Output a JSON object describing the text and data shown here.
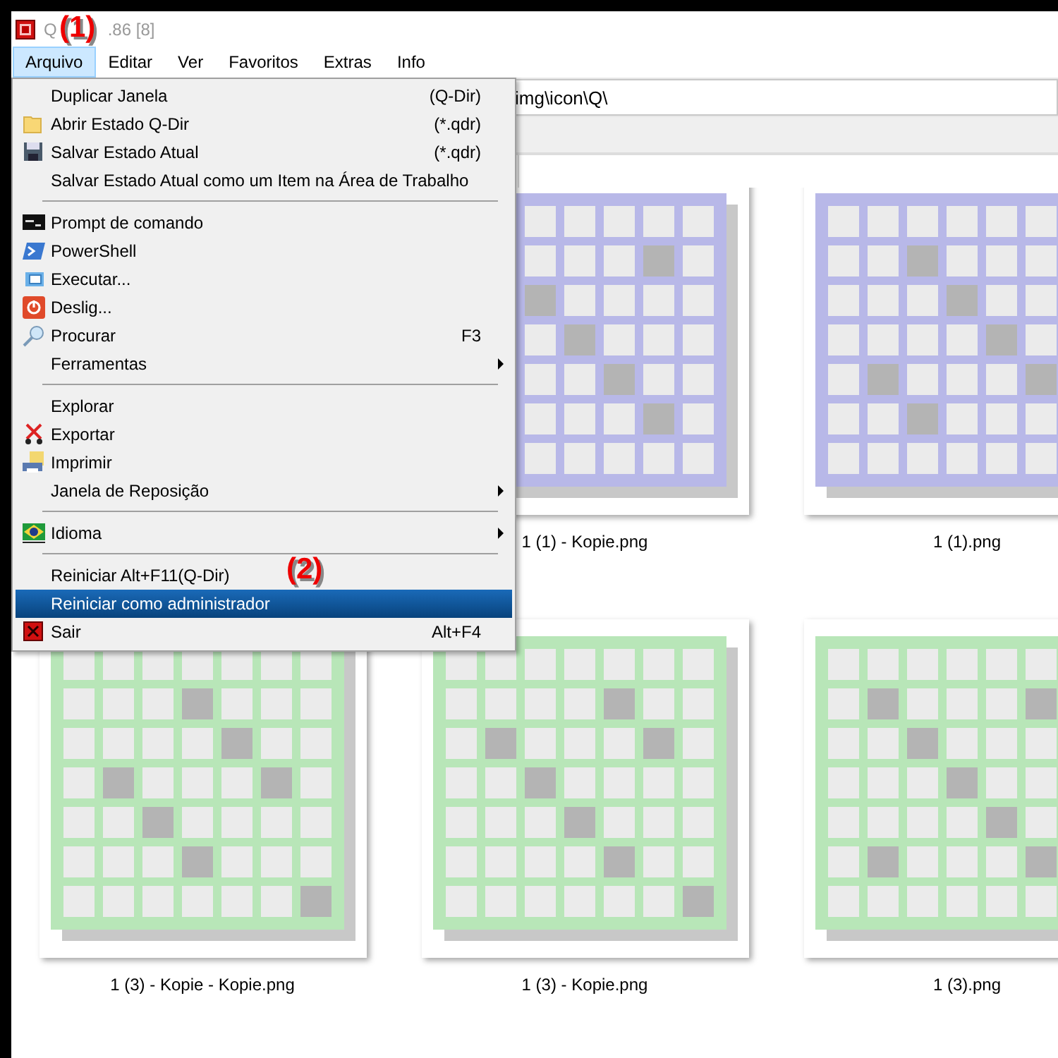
{
  "window": {
    "title_parts": [
      "Q",
      ".86 [8]"
    ]
  },
  "menu_bar": [
    {
      "label": "Arquivo",
      "selected": true
    },
    {
      "label": "Editar",
      "selected": false
    },
    {
      "label": "Ver",
      "selected": false
    },
    {
      "label": "Favoritos",
      "selected": false
    },
    {
      "label": "Extras",
      "selected": false
    },
    {
      "label": "Info",
      "selected": false
    }
  ],
  "address": {
    "value": "img\\icon\\Q\\"
  },
  "menu": [
    {
      "kind": "item",
      "label": "Duplicar Janela",
      "shortcut": "(Q-Dir)",
      "selected": false
    },
    {
      "kind": "item",
      "label": "Abrir Estado Q-Dir",
      "shortcut": "(*.qdr)",
      "selected": false
    },
    {
      "kind": "item",
      "label": "Salvar Estado Atual",
      "shortcut": "(*.qdr)",
      "selected": false
    },
    {
      "kind": "item",
      "label": "Salvar Estado Atual como um Item na Área de Trabalho",
      "selected": false
    },
    {
      "kind": "separator"
    },
    {
      "kind": "item",
      "label": "Prompt de comando",
      "selected": false
    },
    {
      "kind": "item",
      "label": "PowerShell",
      "selected": false
    },
    {
      "kind": "item",
      "label": "Executar...",
      "selected": false
    },
    {
      "kind": "item",
      "label": "Deslig...",
      "selected": false
    },
    {
      "kind": "item",
      "label": "Procurar",
      "shortcut": "F3",
      "selected": false
    },
    {
      "kind": "item",
      "label": "Ferramentas",
      "submenu": true,
      "selected": false
    },
    {
      "kind": "separator"
    },
    {
      "kind": "item",
      "label": "Explorar",
      "selected": false
    },
    {
      "kind": "item",
      "label": "Exportar",
      "selected": false
    },
    {
      "kind": "item",
      "label": "Imprimir",
      "selected": false
    },
    {
      "kind": "item",
      "label": "Janela de Reposição",
      "submenu": true,
      "selected": false
    },
    {
      "kind": "separator"
    },
    {
      "kind": "item",
      "label": "Idioma",
      "submenu": true,
      "selected": false
    },
    {
      "kind": "separator"
    },
    {
      "kind": "item",
      "label": "Reiniciar Alt+F11(Q-Dir)",
      "selected": false
    },
    {
      "kind": "item",
      "label": "Reiniciar como administrador",
      "selected": true
    },
    {
      "kind": "item",
      "label": "Sair",
      "shortcut": "Alt+F4",
      "selected": false
    }
  ],
  "thumbnail_rows": [
    {
      "items": [
        {
          "name": "1 (1) - Kopie.png",
          "color": "#b8b8e8"
        },
        {
          "name": "1 (1).png",
          "color": "#b8b8e8"
        }
      ]
    },
    {
      "items": [
        {
          "name": "1 (3) - Kopie - Kopie.png",
          "color": "#b8e6b8"
        },
        {
          "name": "1 (3) - Kopie.png",
          "color": "#b8e6b8"
        },
        {
          "name": "1 (3).png",
          "color": "#b8e6b8"
        }
      ]
    }
  ],
  "annotations": [
    "(1)",
    "(2)"
  ]
}
